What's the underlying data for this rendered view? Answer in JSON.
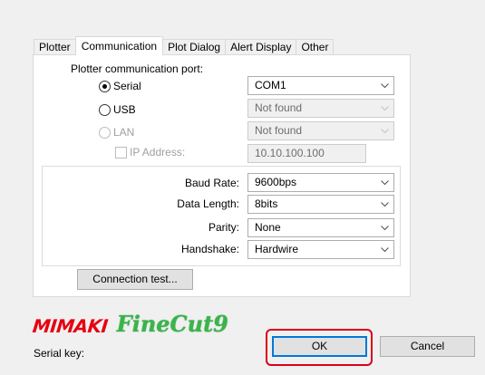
{
  "tabs": [
    {
      "label": "Plotter"
    },
    {
      "label": "Communication"
    },
    {
      "label": "Plot Dialog"
    },
    {
      "label": "Alert Display"
    },
    {
      "label": "Other"
    }
  ],
  "active_tab": "Communication",
  "port": {
    "label": "Plotter communication port:",
    "serial": {
      "label": "Serial",
      "checked": true,
      "value": "COM1"
    },
    "usb": {
      "label": "USB",
      "checked": false,
      "value": "Not found"
    },
    "lan": {
      "label": "LAN",
      "checked": false,
      "disabled": true,
      "value": "Not found"
    },
    "ip": {
      "label": "IP Address:",
      "value": "10.10.100.100"
    }
  },
  "serial_settings": {
    "baud_rate": {
      "label": "Baud Rate:",
      "value": "9600bps"
    },
    "data_length": {
      "label": "Data Length:",
      "value": "8bits"
    },
    "parity": {
      "label": "Parity:",
      "value": "None"
    },
    "handshake": {
      "label": "Handshake:",
      "value": "Hardwire"
    }
  },
  "connection_test_label": "Connection test...",
  "brand": {
    "mimaki": "MIMAKI",
    "product": "FineCut9"
  },
  "serial_key_label": "Serial key:",
  "ok_label": "OK",
  "cancel_label": "Cancel",
  "colors": {
    "accent": "#0078d7",
    "highlight": "#d9001b",
    "brand_red": "#e50012",
    "brand_green": "#39b54a"
  },
  "icons": {
    "dropdown": "chevron-down-icon"
  }
}
